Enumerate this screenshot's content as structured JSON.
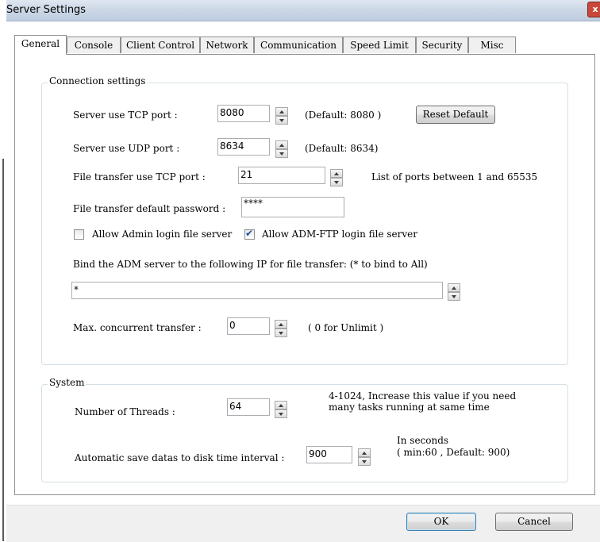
{
  "window": {
    "title": "Server Settings",
    "close_glyph": "x"
  },
  "tabs": [
    "General",
    "Console",
    "Client Control",
    "Network",
    "Communication",
    "Speed Limit",
    "Security",
    "Misc"
  ],
  "active_tab": "General",
  "connection": {
    "group_label": "Connection settings",
    "tcp_port": {
      "label": "Server use TCP port :",
      "value": "8080",
      "hint": "(Default: 8080 )"
    },
    "reset_button": "Reset Default",
    "udp_port": {
      "label": "Server use UDP port :",
      "value": "8634",
      "hint": "(Default: 8634)"
    },
    "ft_tcp_port": {
      "label": "File transfer use TCP port :",
      "value": "21",
      "hint": "List of ports between 1 and 65535"
    },
    "ft_password": {
      "label": "File transfer default password :",
      "value": "****"
    },
    "allow_admin": {
      "label": "Allow Admin login file server",
      "checked": false
    },
    "allow_admftp": {
      "label": "Allow ADM-FTP login file server",
      "checked": true
    },
    "bind_label": "Bind the ADM server to the following IP for file transfer: (* to bind to All)",
    "bind_value": "*",
    "max_transfer": {
      "label": "Max. concurrent transfer :",
      "value": "0",
      "hint": "( 0 for Unlimit )"
    }
  },
  "system": {
    "group_label": "System",
    "threads": {
      "label": "Number of Threads :",
      "value": "64",
      "hint_line1": "4-1024, Increase this value if you need",
      "hint_line2": "many tasks running at same time"
    },
    "autosave": {
      "label": "Automatic save datas to disk time interval :",
      "value": "900",
      "hint_line1": "In seconds",
      "hint_line2": "( min:60 , Default: 900)"
    }
  },
  "footer": {
    "ok": "OK",
    "cancel": "Cancel"
  },
  "colors": {
    "titlebar": "#cdd8e6",
    "close": "#c9483b",
    "default_button_border": "#3c7fb1"
  }
}
